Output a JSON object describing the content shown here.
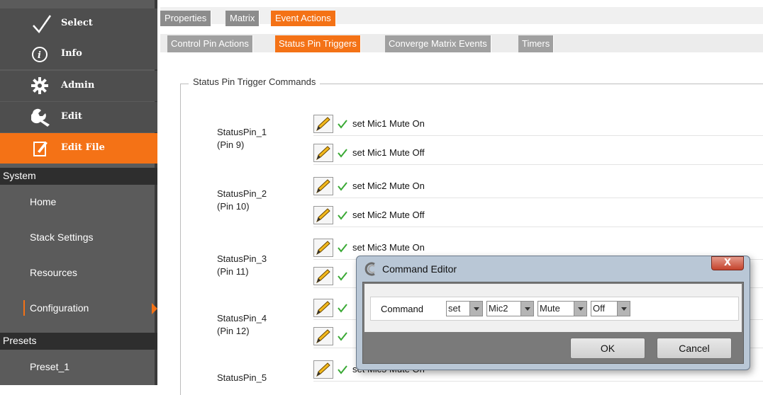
{
  "sidebar": {
    "nav": [
      {
        "label": "Select",
        "icon": "check-icon"
      },
      {
        "label": "Info",
        "icon": "info-icon"
      },
      {
        "label": "Admin",
        "icon": "gear-icon"
      },
      {
        "label": "Edit",
        "icon": "wrench-icon"
      },
      {
        "label": "Edit File",
        "icon": "edit-file-icon",
        "active": true
      }
    ],
    "sections": [
      {
        "title": "System",
        "items": [
          "Home",
          "Stack Settings",
          "Resources",
          "Configuration"
        ],
        "selected": "Configuration"
      },
      {
        "title": "Presets",
        "items": [
          "Preset_1"
        ]
      }
    ]
  },
  "tabs": [
    "Properties",
    "Matrix",
    "Event Actions"
  ],
  "active_tab": "Event Actions",
  "subtabs": [
    "Control Pin Actions",
    "Status Pin Triggers",
    "Converge Matrix Events",
    "Timers"
  ],
  "active_subtab": "Status Pin Triggers",
  "group_title": "Status Pin Trigger Commands",
  "pins": [
    {
      "name": "StatusPin_1",
      "pin": "(Pin 9)",
      "commands": [
        "set Mic1 Mute On",
        "set Mic1 Mute Off"
      ]
    },
    {
      "name": "StatusPin_2",
      "pin": "(Pin 10)",
      "commands": [
        "set Mic2 Mute On",
        "set Mic2 Mute Off"
      ]
    },
    {
      "name": "StatusPin_3",
      "pin": "(Pin 11)",
      "commands": [
        "set Mic3 Mute On",
        ""
      ]
    },
    {
      "name": "StatusPin_4",
      "pin": "(Pin 12)",
      "commands": [
        "",
        ""
      ]
    },
    {
      "name": "StatusPin_5",
      "pin": "",
      "commands": [
        "set Mic5 Mute On"
      ]
    }
  ],
  "dialog": {
    "title": "Command Editor",
    "close_label": "X",
    "command_label": "Command",
    "combos": [
      "set",
      "Mic2",
      "Mute",
      "Off"
    ],
    "ok_label": "OK",
    "cancel_label": "Cancel"
  },
  "colors": {
    "accent": "#f47216",
    "sidebar": "#5b5b5b",
    "check": "#3aa935"
  }
}
